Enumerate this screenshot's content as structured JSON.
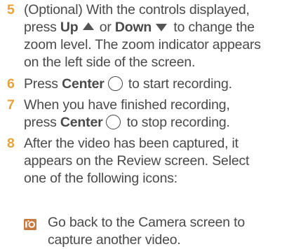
{
  "steps": [
    {
      "number": "5",
      "lines": [
        "(Optional) With the controls displayed,",
        {
          "pre": "press ",
          "key1": "Up",
          "mid": " or ",
          "key2": "Down",
          "post": " to change the"
        },
        "zoom level. The zoom indicator appears",
        "on the left side of the screen."
      ]
    },
    {
      "number": "6",
      "line": {
        "pre": "Press ",
        "key": "Center",
        "post": " to start recording."
      }
    },
    {
      "number": "7",
      "lines": [
        "When you have finished recording,",
        {
          "pre": "press ",
          "key": "Center",
          "post": " to stop recording."
        }
      ]
    },
    {
      "number": "8",
      "lines": [
        "After the video has been captured, it",
        "appears on the Review screen. Select",
        "one of the following icons:"
      ]
    }
  ],
  "icon_items": [
    {
      "icon": "camera-icon",
      "lines": [
        "Go back to the Camera screen to",
        "capture another video."
      ]
    }
  ],
  "icons": {
    "up": "up-triangle-icon",
    "down": "down-triangle-icon",
    "center": "center-circle-icon"
  },
  "colors": {
    "step_number": "#e8a23a",
    "text": "#4a4a4a",
    "icon_bg": "#c77a3e"
  }
}
